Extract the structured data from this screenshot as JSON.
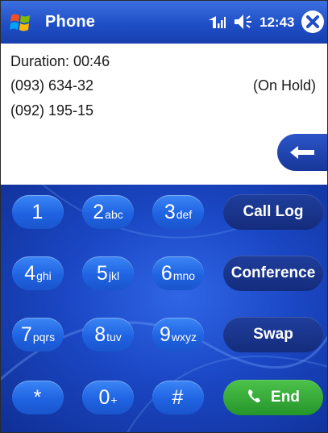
{
  "titlebar": {
    "app_title": "Phone",
    "clock": "12:43",
    "icons": [
      "windows-start-icon",
      "signal-icon",
      "volume-icon",
      "close-icon"
    ]
  },
  "call": {
    "duration": "Duration: 00:46",
    "lines": [
      {
        "number": "(093) 634-32",
        "status": "(On Hold)"
      },
      {
        "number": "(092) 195-15",
        "status": ""
      }
    ]
  },
  "keypad": {
    "keys": [
      {
        "digit": "1",
        "letters": ""
      },
      {
        "digit": "2",
        "letters": "abc"
      },
      {
        "digit": "3",
        "letters": "def"
      },
      {
        "digit": "4",
        "letters": "ghi"
      },
      {
        "digit": "5",
        "letters": "jkl"
      },
      {
        "digit": "6",
        "letters": "mno"
      },
      {
        "digit": "7",
        "letters": "pqrs"
      },
      {
        "digit": "8",
        "letters": "tuv"
      },
      {
        "digit": "9",
        "letters": "wxyz"
      },
      {
        "digit": "*",
        "letters": ""
      },
      {
        "digit": "0",
        "letters": "+"
      },
      {
        "digit": "#",
        "letters": ""
      }
    ],
    "actions": {
      "call_log": "Call Log",
      "conference": "Conference",
      "swap": "Swap",
      "end": "End"
    }
  },
  "colors": {
    "titlebar": "#1f4fc6",
    "keypad_bg": "#1b47c4",
    "key": "#2a72ec",
    "action": "#17348a",
    "end": "#2fa535"
  }
}
